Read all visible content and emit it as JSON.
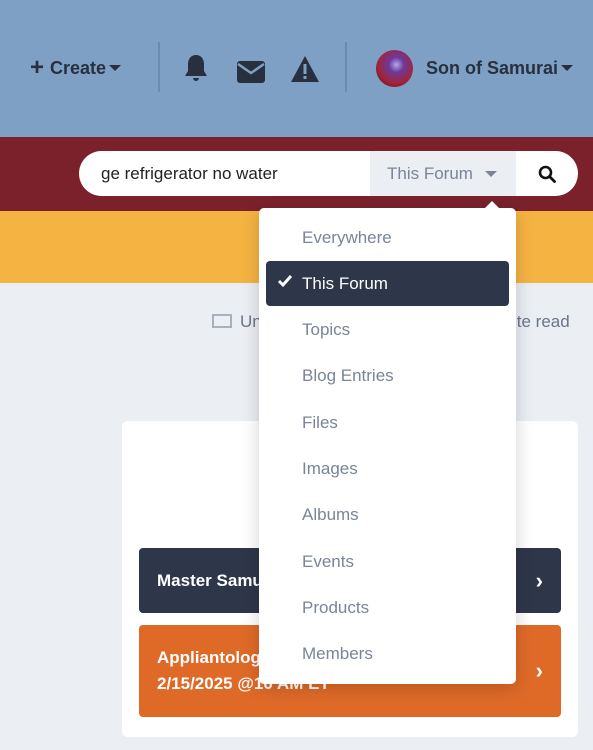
{
  "header": {
    "create_label": "Create",
    "user_name": "Son of Samurai",
    "icons": [
      "plus-icon",
      "bell-icon",
      "envelope-icon",
      "warning-icon"
    ]
  },
  "search": {
    "value": "ge refrigerator no water",
    "scope": "This Forum"
  },
  "links": {
    "unread": "Unread content",
    "mark_read": "Mark site read"
  },
  "cards": [
    {
      "title": "Master Samurai",
      "color": "#2e3649"
    },
    {
      "title": "Appliantology",
      "subtitle": "2/15/2025 @10 AM ET",
      "color": "#df6a28"
    }
  ],
  "dropdown": {
    "selected": "This Forum",
    "items": [
      "Everywhere",
      "This Forum",
      "Topics",
      "Blog Entries",
      "Files",
      "Images",
      "Albums",
      "Events",
      "Products",
      "Members"
    ]
  },
  "colors": {
    "header": "#7ea0c4",
    "maroon": "#7a212c",
    "yellow": "#f5b342"
  }
}
